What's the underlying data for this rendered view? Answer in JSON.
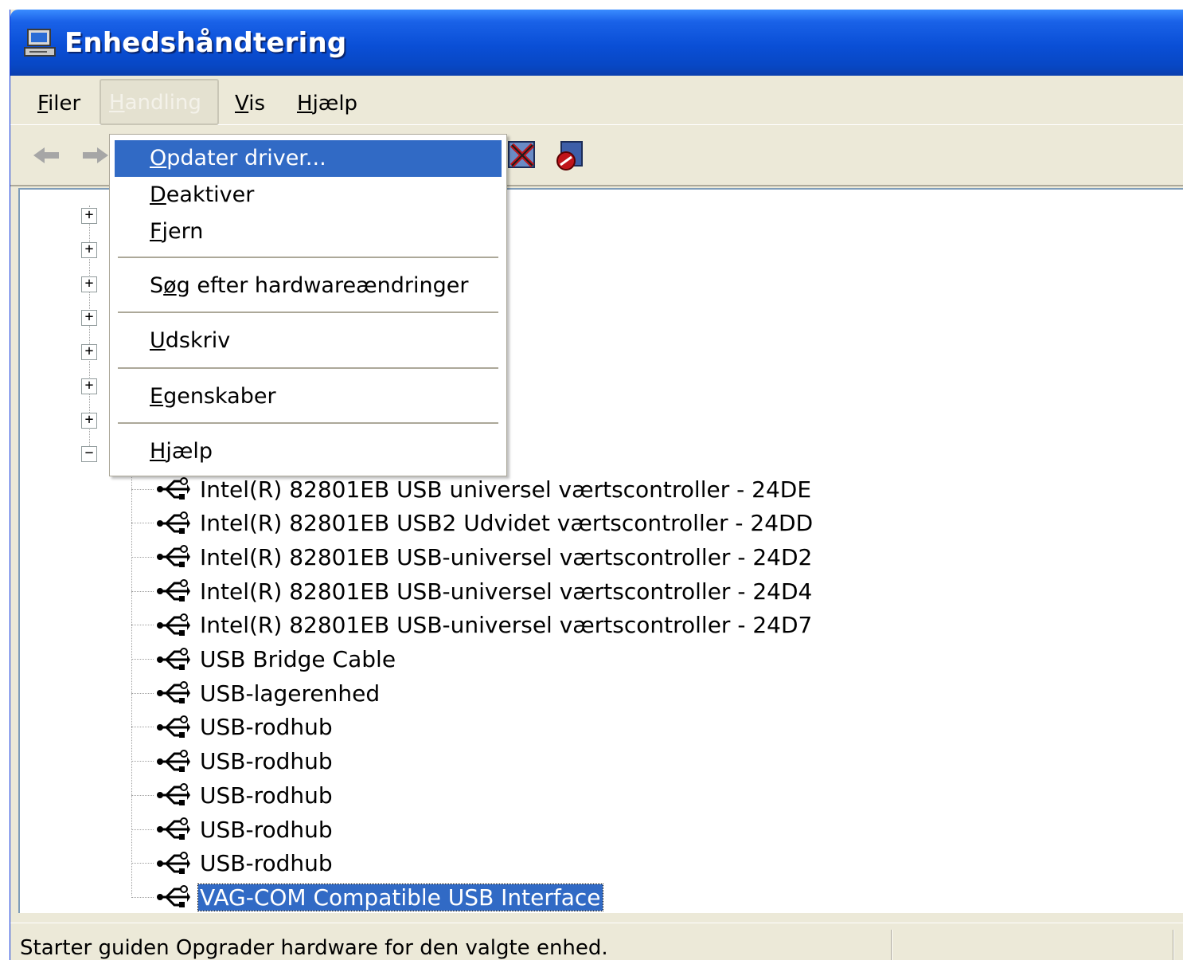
{
  "window": {
    "title": "Enhedshåndtering"
  },
  "menubar": {
    "items": [
      {
        "pre": "",
        "key": "F",
        "post": "iler"
      },
      {
        "pre": "",
        "key": "H",
        "post": "andling"
      },
      {
        "pre": "",
        "key": "V",
        "post": "is"
      },
      {
        "pre": "",
        "key": "H",
        "post": "jælp"
      }
    ]
  },
  "dropdown": {
    "items": [
      {
        "key": "O",
        "rest": "pdater driver..."
      },
      {
        "key": "D",
        "rest": "eaktiver"
      },
      {
        "key": "F",
        "rest": "jern"
      },
      {
        "pre": "S",
        "key": "ø",
        "rest": "g efter hardwareændringer"
      },
      {
        "key": "U",
        "rest": "dskriv"
      },
      {
        "key": "E",
        "rest": "genskaber"
      },
      {
        "key": "H",
        "rest": "jælp"
      }
    ]
  },
  "tree": {
    "usb_children": [
      "Intel(R) 82801EB USB universel værtscontroller - 24DE",
      "Intel(R) 82801EB USB2 Udvidet værtscontroller - 24DD",
      "Intel(R) 82801EB USB-universel værtscontroller - 24D2",
      "Intel(R) 82801EB USB-universel værtscontroller - 24D4",
      "Intel(R) 82801EB USB-universel værtscontroller - 24D7",
      "USB Bridge Cable",
      "USB-lagerenhed",
      "USB-rodhub",
      "USB-rodhub",
      "USB-rodhub",
      "USB-rodhub",
      "USB-rodhub",
      "VAG-COM Compatible USB Interface"
    ],
    "expander_symbols": [
      "+",
      "+",
      "+",
      "+",
      "+",
      "+",
      "+",
      "−"
    ]
  },
  "statusbar": {
    "text": "Starter guiden Opgrader hardware for den valgte enhed."
  },
  "colors": {
    "title_bar": "#0a4fd6",
    "selection": "#316ac5",
    "window_bg": "#ece9d8"
  }
}
